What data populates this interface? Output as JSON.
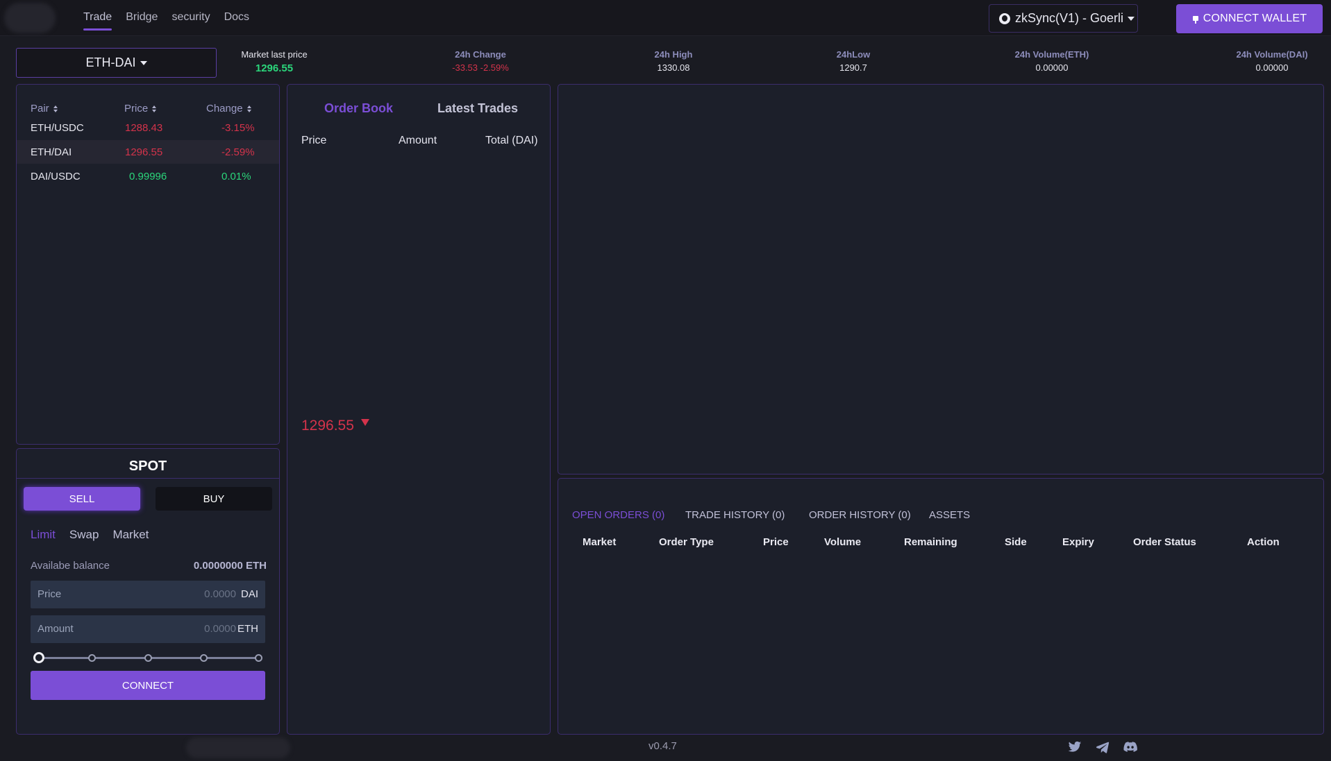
{
  "nav": {
    "items": [
      "Trade",
      "Bridge",
      "security",
      "Docs"
    ]
  },
  "network": {
    "label": "zkSync(V1) - Goerli"
  },
  "header": {
    "connect_wallet": "CONNECT WALLET"
  },
  "pair_selector": {
    "value": "ETH-DAI"
  },
  "stats": {
    "last_price": {
      "label": "Market last price",
      "value": "1296.55"
    },
    "change": {
      "label": "24h Change",
      "value": "-33.53 -2.59%"
    },
    "high": {
      "label": "24h High",
      "value": "1330.08"
    },
    "low": {
      "label": "24hLow",
      "value": "1290.7"
    },
    "vol_eth": {
      "label": "24h Volume(ETH)",
      "value": "0.00000"
    },
    "vol_dai": {
      "label": "24h Volume(DAI)",
      "value": "0.00000"
    }
  },
  "pairs": {
    "headers": [
      "Pair",
      "Price",
      "Change"
    ],
    "rows": [
      {
        "pair": "ETH/USDC",
        "price": "1288.43",
        "change": "-3.15%"
      },
      {
        "pair": "ETH/DAI",
        "price": "1296.55",
        "change": "-2.59%"
      },
      {
        "pair": "DAI/USDC",
        "price": "0.99996",
        "change": "0.01%"
      }
    ]
  },
  "spot": {
    "title": "SPOT",
    "sell": "SELL",
    "buy": "BUY",
    "order_types": [
      "Limit",
      "Swap",
      "Market"
    ],
    "balance_label": "Availabe balance",
    "balance_value": "0.0000000 ETH",
    "price": {
      "label": "Price",
      "value": "0.0000",
      "unit": "DAI"
    },
    "amount": {
      "label": "Amount",
      "value": "0.0000",
      "unit": "ETH"
    },
    "slider_value": 0,
    "connect": "CONNECT"
  },
  "orderbook": {
    "tabs": [
      "Order Book",
      "Latest Trades"
    ],
    "headers": [
      "Price",
      "Amount",
      "Total (DAI)"
    ],
    "last_price": "1296.55"
  },
  "orders": {
    "tabs": [
      "OPEN ORDERS (0)",
      "TRADE HISTORY (0)",
      "ORDER HISTORY (0)",
      "ASSETS"
    ],
    "headers": [
      "Market",
      "Order Type",
      "Price",
      "Volume",
      "Remaining",
      "Side",
      "Expiry",
      "Order Status",
      "Action"
    ]
  },
  "footer": {
    "version": "v0.4.7",
    "social": [
      "twitter-icon",
      "telegram-icon",
      "discord-icon"
    ]
  },
  "colors": {
    "accent": "#7b4ed6",
    "down": "#d4334b",
    "up": "#2bd67b"
  }
}
